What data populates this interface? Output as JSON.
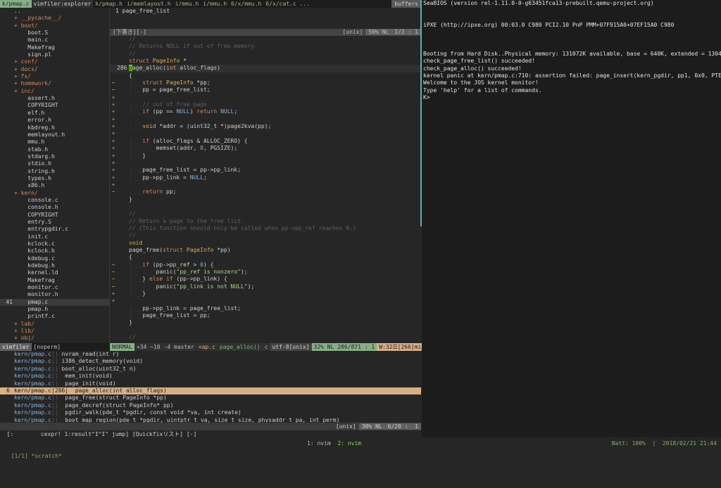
{
  "tabline": {
    "tabs": [
      {
        "label": "k/pmap.c",
        "active": true
      },
      {
        "label": "vimfiler:explorer",
        "active": false
      },
      {
        "label": "k/pmap.h",
        "active": false
      },
      {
        "label": "i/memlayout.h",
        "active": false
      },
      {
        "label": "i/mmu.h",
        "active": false
      },
      {
        "label": "i/mmu.h",
        "active": false
      },
      {
        "label": "6/x/mmu.h",
        "active": false
      },
      {
        "label": "6/x/cat.c ...",
        "active": false
      }
    ],
    "buffers_label": "buffers"
  },
  "explorer": {
    "rows": [
      {
        "ln": "",
        "text": "..",
        "kind": "file"
      },
      {
        "ln": "",
        "text": "+ __pycache__/",
        "kind": "dir"
      },
      {
        "ln": "",
        "text": "+ boot/",
        "kind": "dir"
      },
      {
        "ln": "",
        "text": "    boot.S",
        "kind": "file"
      },
      {
        "ln": "",
        "text": "    main.c",
        "kind": "file"
      },
      {
        "ln": "",
        "text": "    Makefrag",
        "kind": "file"
      },
      {
        "ln": "",
        "text": "    sign.pl",
        "kind": "file"
      },
      {
        "ln": "",
        "text": "+ conf/",
        "kind": "dir"
      },
      {
        "ln": "",
        "text": "+ docs/",
        "kind": "dir"
      },
      {
        "ln": "",
        "text": "+ fs/",
        "kind": "dir"
      },
      {
        "ln": "",
        "text": "+ homework/",
        "kind": "dir"
      },
      {
        "ln": "",
        "text": "+ inc/",
        "kind": "dir"
      },
      {
        "ln": "",
        "text": "    assert.h",
        "kind": "file"
      },
      {
        "ln": "",
        "text": "    COPYRIGHT",
        "kind": "file"
      },
      {
        "ln": "",
        "text": "    elf.h",
        "kind": "file"
      },
      {
        "ln": "",
        "text": "    error.h",
        "kind": "file"
      },
      {
        "ln": "",
        "text": "    kbdreg.h",
        "kind": "file"
      },
      {
        "ln": "",
        "text": "    memlayout.h",
        "kind": "file"
      },
      {
        "ln": "",
        "text": "    mmu.h",
        "kind": "file"
      },
      {
        "ln": "",
        "text": "    stab.h",
        "kind": "file"
      },
      {
        "ln": "",
        "text": "    stdarg.h",
        "kind": "file"
      },
      {
        "ln": "",
        "text": "    stdio.h",
        "kind": "file"
      },
      {
        "ln": "",
        "text": "    string.h",
        "kind": "file"
      },
      {
        "ln": "",
        "text": "    types.h",
        "kind": "file"
      },
      {
        "ln": "",
        "text": "    x86.h",
        "kind": "file"
      },
      {
        "ln": "",
        "text": "+ kern/",
        "kind": "dir"
      },
      {
        "ln": "",
        "text": "    console.c",
        "kind": "file"
      },
      {
        "ln": "",
        "text": "    console.h",
        "kind": "file"
      },
      {
        "ln": "",
        "text": "    COPYRIGHT",
        "kind": "file"
      },
      {
        "ln": "",
        "text": "    entry.S",
        "kind": "file"
      },
      {
        "ln": "",
        "text": "    entrypgdir.c",
        "kind": "file"
      },
      {
        "ln": "",
        "text": "    init.c",
        "kind": "file"
      },
      {
        "ln": "",
        "text": "    kclock.c",
        "kind": "file"
      },
      {
        "ln": "",
        "text": "    kclock.h",
        "kind": "file"
      },
      {
        "ln": "",
        "text": "    kdebug.c",
        "kind": "file"
      },
      {
        "ln": "",
        "text": "    kdebug.h",
        "kind": "file"
      },
      {
        "ln": "",
        "text": "    kernel.ld",
        "kind": "file"
      },
      {
        "ln": "",
        "text": "    Makefrag",
        "kind": "file"
      },
      {
        "ln": "",
        "text": "    monitor.c",
        "kind": "file"
      },
      {
        "ln": "",
        "text": "    monitor.h",
        "kind": "file"
      },
      {
        "ln": "41",
        "text": "    pmap.c",
        "kind": "file",
        "current": true
      },
      {
        "ln": "",
        "text": "    pmap.h",
        "kind": "file"
      },
      {
        "ln": "",
        "text": "    printf.c",
        "kind": "file"
      },
      {
        "ln": "",
        "text": "+ lab/",
        "kind": "dir"
      },
      {
        "ln": "",
        "text": "+ lib/",
        "kind": "dir"
      },
      {
        "ln": "",
        "text": "+ obj/",
        "kind": "dir"
      }
    ]
  },
  "preview": {
    "line": "1 page_free_list",
    "bar_left": "[下書き][-]",
    "bar_ff": "[unix]",
    "bar_pct": "50% NL",
    "bar_pos": "1/2 :  1"
  },
  "editor": {
    "rows": [
      {
        "sg": "",
        "ln": "",
        "html": "<span class='c'>//</span>"
      },
      {
        "sg": "",
        "ln": "",
        "html": "<span class='c'>// Returns NULL if out of free memory.</span>"
      },
      {
        "sg": "",
        "ln": "",
        "html": "<span class='c'>//</span>"
      },
      {
        "sg": "",
        "ln": "",
        "html": "<span class='k'>struct</span> <span class='t'>PageInfo</span> *"
      },
      {
        "sg": "",
        "ln": "286",
        "cur": true,
        "html": "<span class='cursor'>p</span>age_alloc(<span class='t'>int</span> alloc_flags)"
      },
      {
        "sg": "",
        "ln": "",
        "html": "{"
      },
      {
        "sg": "~",
        "ln": "",
        "html": "<span class='g'>|___</span><span class='k'>struct</span> <span class='t'>PageInfo</span> *pp;"
      },
      {
        "sg": "~",
        "ln": "",
        "html": "<span class='g'>|___</span>pp = page_free_list;"
      },
      {
        "sg": "+",
        "ln": "",
        "html": ""
      },
      {
        "sg": "+",
        "ln": "",
        "html": "<span class='g'>|___</span><span class='c'>// out of free page</span>"
      },
      {
        "sg": "+",
        "ln": "",
        "html": "<span class='g'>|___</span><span class='k'>if</span> (pp == <span class='n'>NULL</span>) <span class='k'>return</span> <span class='n'>NULL</span>;"
      },
      {
        "sg": "+",
        "ln": "",
        "html": ""
      },
      {
        "sg": "+",
        "ln": "",
        "html": "<span class='g'>|___</span><span class='t'>void</span> *addr = (uint32_t *)page2kva(pp);"
      },
      {
        "sg": "+",
        "ln": "",
        "html": ""
      },
      {
        "sg": "+",
        "ln": "",
        "html": "<span class='g'>|___</span><span class='k'>if</span> (alloc_flags &amp; ALLOC_ZERO) {"
      },
      {
        "sg": "+",
        "ln": "",
        "html": "<span class='g'>|___|___</span>memset(addr, <span class='n'>0</span>, PGSIZE);"
      },
      {
        "sg": "+",
        "ln": "",
        "html": "<span class='g'>|___</span>}"
      },
      {
        "sg": "+",
        "ln": "",
        "html": ""
      },
      {
        "sg": "+",
        "ln": "",
        "html": "<span class='g'>|___</span>page_free_list = pp-&gt;pp_link;"
      },
      {
        "sg": "+",
        "ln": "",
        "html": "<span class='g'>|___</span>pp-&gt;pp_link = <span class='n'>NULL</span>;"
      },
      {
        "sg": "+",
        "ln": "",
        "html": ""
      },
      {
        "sg": "~",
        "ln": "",
        "html": "<span class='g'>|___</span><span class='k'>return</span> pp;"
      },
      {
        "sg": "",
        "ln": "",
        "html": "}"
      },
      {
        "sg": "",
        "ln": "",
        "html": ""
      },
      {
        "sg": "",
        "ln": "",
        "html": "<span class='c'>//</span>"
      },
      {
        "sg": "",
        "ln": "",
        "html": "<span class='c'>// Return a page to the free list.</span>"
      },
      {
        "sg": "",
        "ln": "",
        "html": "<span class='c'>// (This function should only be called when pp-&gt;pp_ref reaches 0.)</span>"
      },
      {
        "sg": "",
        "ln": "",
        "html": "<span class='c'>//</span>"
      },
      {
        "sg": "",
        "ln": "",
        "html": "<span class='t'>void</span>"
      },
      {
        "sg": "",
        "ln": "",
        "html": "page_free(<span class='k'>struct</span> <span class='t'>PageInfo</span> *pp)"
      },
      {
        "sg": "",
        "ln": "",
        "html": "{"
      },
      {
        "sg": "~",
        "ln": "",
        "html": "<span class='g'>|___</span><span class='k'>if</span> (pp-&gt;pp_ref &gt; <span class='n'>0</span>) {"
      },
      {
        "sg": "~",
        "ln": "",
        "html": "<span class='g'>|___|___</span>panic(<span class='s'>\"pp_ref is nonzero\"</span>);"
      },
      {
        "sg": "~",
        "ln": "",
        "html": "<span class='g'>|___</span>} <span class='k'>else if</span> (pp-&gt;pp_link) {"
      },
      {
        "sg": "~",
        "ln": "",
        "html": "<span class='g'>|___|___</span>panic(<span class='s'>\"pp_link is not NULL\"</span>);"
      },
      {
        "sg": "+",
        "ln": "",
        "html": "<span class='g'>|___</span>}"
      },
      {
        "sg": "+",
        "ln": "",
        "html": ""
      },
      {
        "sg": "",
        "ln": "",
        "html": "<span class='g'>|___</span>pp-&gt;pp_link = page_free_list;"
      },
      {
        "sg": "",
        "ln": "",
        "html": "<span class='g'>|___</span>page_free_list = pp;"
      },
      {
        "sg": "",
        "ln": "",
        "html": "}"
      },
      {
        "sg": "",
        "ln": "",
        "html": ""
      },
      {
        "sg": "",
        "ln": "",
        "html": "<span class='c'>//</span>"
      }
    ]
  },
  "statusline": {
    "left_a": "vimfiler",
    "left_b": "[noperm]",
    "mode": "NORMAL",
    "git": "+34 ~10 -4 master",
    "file": "<ap.c",
    "func": "page_alloc()",
    "ft": "c",
    "enc": "utf-8[unix]",
    "pos": "32% NL 286/871 :  1",
    "warn": "W:32☰[266]mi…"
  },
  "quickfix": {
    "rows": [
      {
        "ln": "",
        "file": "kern/pmap.c",
        "lnum": "",
        "text": "nvram_read(int r)"
      },
      {
        "ln": "",
        "file": "kern/pmap.c",
        "lnum": "",
        "text": "i386_detect_memory(void)"
      },
      {
        "ln": "",
        "file": "kern/pmap.c",
        "lnum": "",
        "text": "boot_alloc(uint32_t n)"
      },
      {
        "ln": "",
        "file": "kern/pmap.c",
        "lnum": "",
        "text": " mem_init(void)"
      },
      {
        "ln": "",
        "file": "kern/pmap.c",
        "lnum": "",
        "text": " page_init(void)"
      },
      {
        "ln": "6",
        "file": "kern/pmap.c",
        "lnum": "286",
        "text": " page_alloc(int alloc_flags)",
        "current": true
      },
      {
        "ln": "",
        "file": "kern/pmap.c",
        "lnum": "",
        "text": " page_free(struct PageInfo *pp)"
      },
      {
        "ln": "",
        "file": "kern/pmap.c",
        "lnum": "",
        "text": " page_decref(struct PageInfo* pp)"
      },
      {
        "ln": "",
        "file": "kern/pmap.c",
        "lnum": "",
        "text": " pgdir_walk(pde_t *pgdir, const void *va, int create)"
      },
      {
        "ln": "",
        "file": "kern/pmap.c",
        "lnum": "",
        "text": " boot_map_region(pde_t *pgdir, uintptr_t va, size_t size, physaddr_t pa, int perm)"
      }
    ],
    "bar_left": "[:        cexpr! 1:result^I^I\" jump] [Quickfixリスト] [-]",
    "bar_ff": "[unix]",
    "bar_pct": "30% NL",
    "bar_pos": "6/20 :  1"
  },
  "terminal": {
    "lines": [
      "SeaBIOS (version rel-1.11.0-0-g63451fca13-prebuilt.qemu-project.org)",
      "",
      "",
      "iPXE (http://ipxe.org) 00:03.0 C980 PCI2.10 PnP PMM+07F915A0+07EF15A0 C980",
      "",
      "",
      "",
      "Booting from Hard Disk..Physical memory: 131072K available, base = 640K, extended = 130432K",
      "check_page_free_list() succeeded!",
      "check_page_alloc() succeeded!",
      "kernel panic at kern/pmap.c:710: assertion failed: page_insert(kern_pgdir, pp1, 0x0, PTE_W) < 0",
      "Welcome to the JOS kernel monitor!",
      "Type 'help' for a list of commands.",
      "K>"
    ]
  },
  "tmux": {
    "left": "[1/1] *scratch*",
    "win1": "1: nvim",
    "win2": "2: nvim",
    "right": "Batt: 100%  |  2018/02/21 21:44"
  }
}
